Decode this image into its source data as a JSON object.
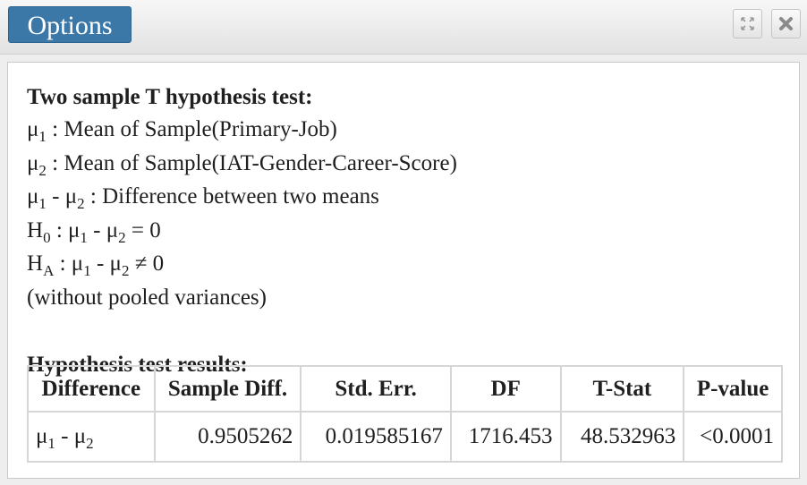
{
  "window": {
    "title_button": "Options",
    "expand_icon": "expand-icon",
    "close_icon": "close-icon"
  },
  "test": {
    "heading": "Two sample T hypothesis test:",
    "mu": "μ",
    "sub1": "1",
    "sub2": "2",
    "sub0": "0",
    "subA": "A",
    "H": "H",
    "mu1_desc": " : Mean of Sample(Primary-Job)",
    "mu2_desc": " : Mean of Sample(IAT-Gender-Career-Score)",
    "minus": " - ",
    "diff_desc": " : Difference between two means",
    "h0_sep": " : ",
    "h0_rel": " = 0",
    "ha_sep": " : ",
    "ha_rel": " ≠ 0",
    "pooled_note": "(without pooled variances)"
  },
  "results": {
    "heading": "Hypothesis test results:",
    "columns": [
      "Difference",
      "Sample Diff.",
      "Std. Err.",
      "DF",
      "T-Stat",
      "P-value"
    ],
    "rows": [
      {
        "sample_diff": "0.9505262",
        "std_err": "0.019585167",
        "df": "1716.453",
        "t_stat": "48.532963",
        "p_value": "<0.0001"
      }
    ]
  }
}
